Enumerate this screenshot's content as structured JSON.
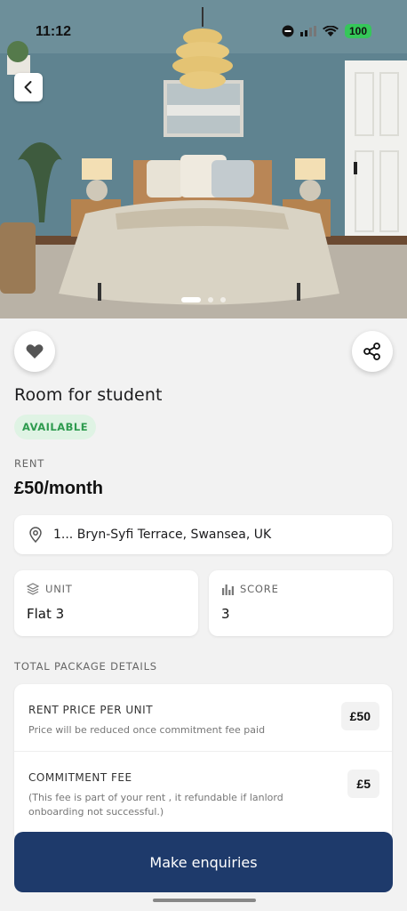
{
  "status_bar": {
    "time": "11:12",
    "battery": "100"
  },
  "listing": {
    "title": "Room for student",
    "status": "AVAILABLE",
    "rent_label": "RENT",
    "rent_value": "£50/month",
    "address": "1... Bryn-Syfi Terrace, Swansea, UK",
    "unit": {
      "label": "UNIT",
      "value": "Flat 3"
    },
    "score": {
      "label": "SCORE",
      "value": "3"
    }
  },
  "package": {
    "section_label": "TOTAL PACKAGE DETAILS",
    "items": [
      {
        "title": "RENT PRICE PER UNIT",
        "desc": "Price will be reduced once commitment fee paid",
        "price": "£50"
      },
      {
        "title": "COMMITMENT FEE",
        "desc": "(This fee is part of your rent , it refundable if lanlord onboarding not successful.)",
        "price": "£5"
      }
    ]
  },
  "carousel": {
    "count": 3,
    "active": 1
  },
  "cta": {
    "label": "Make enquiries"
  },
  "icons": [
    "back-icon",
    "heart-icon",
    "share-icon",
    "location-pin-icon",
    "layers-icon",
    "bar-chart-icon"
  ],
  "colors": {
    "primary": "#1e3a6b",
    "badge_bg": "#dff3e4",
    "badge_text": "#2e9b4f"
  }
}
